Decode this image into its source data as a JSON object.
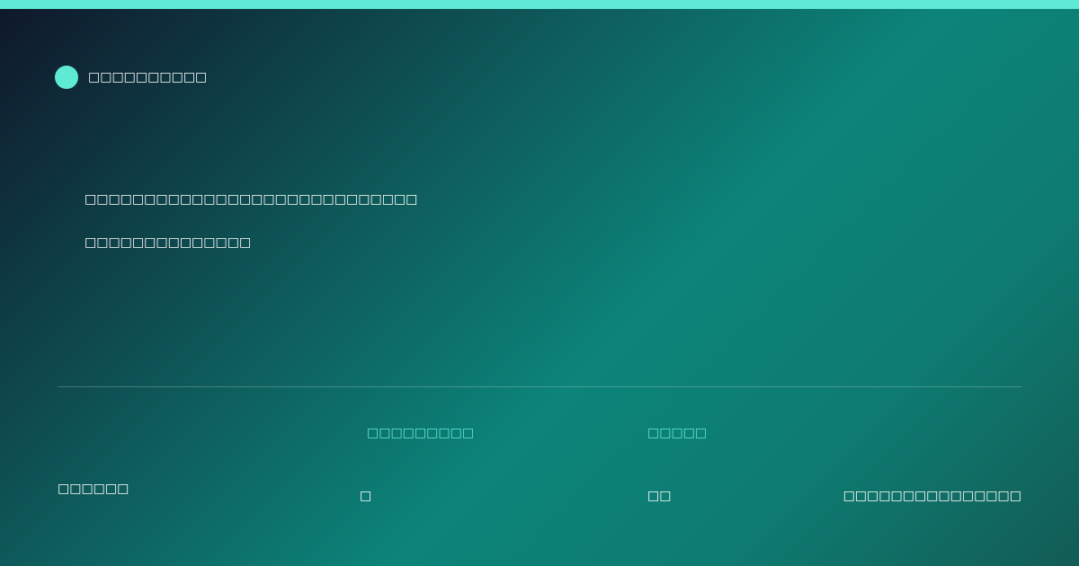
{
  "colors": {
    "accent": "#5eead4",
    "text": "#ffffff",
    "background_start": "#0f172a",
    "background_mid": "#0c8479",
    "background_end": "#125c55"
  },
  "brand": {
    "logo_icon": "circle-logo-icon",
    "name": "□□□□□□□□□□"
  },
  "hero": {
    "headline": "□□□□□□□□□□□□□□□□□□□□□□□□□□□□",
    "subline": "□□□□□□□□□□□□□□"
  },
  "footer": {
    "left_text": "□□□□□□",
    "columns": [
      {
        "label": "□□□□□□□□□",
        "value": "□"
      },
      {
        "label": "□□□□□",
        "value": "□□"
      }
    ],
    "right_text": "□□□□□□□□□□□□□□□"
  }
}
